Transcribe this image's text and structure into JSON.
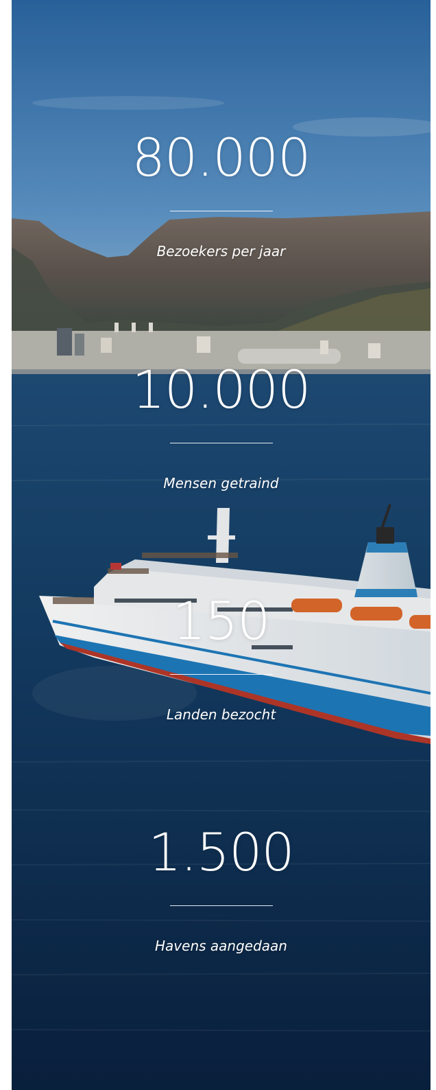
{
  "stats": [
    {
      "number": "80.000",
      "label": "Bezoekers per jaar"
    },
    {
      "number": "10.000",
      "label": "Mensen getraind"
    },
    {
      "number": "150",
      "label": "Landen bezocht"
    },
    {
      "number": "1.500",
      "label": "Havens aangedaan"
    }
  ],
  "colors": {
    "sky_top": "#2e6aa6",
    "sky_bottom": "#8fb7d8",
    "sea": "#123a5e",
    "hull_blue": "#1c78b8",
    "hull_red": "#b8392a",
    "text": "#ffffff"
  }
}
